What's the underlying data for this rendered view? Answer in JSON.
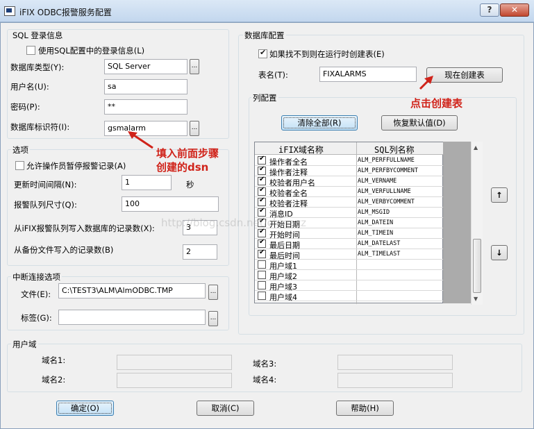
{
  "window": {
    "title": "iFIX ODBC报警服务配置",
    "help_glyph": "?",
    "close_glyph": "✕"
  },
  "sql_login": {
    "title": "SQL 登录信息",
    "use_sql_config_label": "使用SQL配置中的登录信息(L)",
    "use_sql_config_checked": false,
    "db_type_label": "数据库类型(Y):",
    "db_type_value": "SQL Server",
    "username_label": "用户名(U):",
    "username_value": "sa",
    "password_label": "密码(P):",
    "password_value": "**",
    "dsn_label": "数据库标识符(I):",
    "dsn_value": "gsmalarm"
  },
  "options": {
    "title": "选项",
    "allow_pause_label": "允许操作员暂停报警记录(A)",
    "allow_pause_checked": false,
    "update_interval_label": "更新时间间隔(N):",
    "update_interval_value": "1",
    "update_interval_unit": "秒",
    "queue_size_label": "报警队列尺寸(Q):",
    "queue_size_value": "100",
    "write_records_label": "从iFIX报警队列写入数据库的记录数(X):",
    "write_records_value": "3",
    "backup_records_label": "从备份文件写入的记录数(B)",
    "backup_records_value": "2"
  },
  "interrupt": {
    "title": "中断连接选项",
    "file_label": "文件(E):",
    "file_value": "C:\\TEST3\\ALM\\AlmODBC.TMP",
    "tag_label": "标签(G):",
    "tag_value": ""
  },
  "database": {
    "title": "数据库配置",
    "create_if_missing_label": "如果找不到则在运行时创建表(E)",
    "create_if_missing_checked": true,
    "table_label": "表名(T):",
    "table_value": "FIXALARMS",
    "create_now_button": "现在创建表"
  },
  "columns": {
    "title": "列配置",
    "clear_all_button": "清除全部(R)",
    "restore_default_button": "恢复默认值(D)",
    "header_ifix": "iFIX域名称",
    "header_sql": "SQL列名称",
    "rows": [
      {
        "checked": true,
        "ifix": "操作者全名",
        "sql": "ALM_PERFFULLNAME"
      },
      {
        "checked": true,
        "ifix": "操作者注释",
        "sql": "ALM_PERFBYCOMMENT"
      },
      {
        "checked": true,
        "ifix": "校验者用户名",
        "sql": "ALM_VERNAME"
      },
      {
        "checked": true,
        "ifix": "校验者全名",
        "sql": "ALM_VERFULLNAME"
      },
      {
        "checked": true,
        "ifix": "校验者注释",
        "sql": "ALM_VERBYCOMMENT"
      },
      {
        "checked": true,
        "ifix": "消息ID",
        "sql": "ALM_MSGID"
      },
      {
        "checked": true,
        "ifix": "开始日期",
        "sql": "ALM_DATEIN"
      },
      {
        "checked": true,
        "ifix": "开始时间",
        "sql": "ALM_TIMEIN"
      },
      {
        "checked": true,
        "ifix": "最后日期",
        "sql": "ALM_DATELAST"
      },
      {
        "checked": true,
        "ifix": "最后时间",
        "sql": "ALM_TIMELAST"
      },
      {
        "checked": false,
        "ifix": "用户域1",
        "sql": ""
      },
      {
        "checked": false,
        "ifix": "用户域2",
        "sql": ""
      },
      {
        "checked": false,
        "ifix": "用户域3",
        "sql": ""
      },
      {
        "checked": false,
        "ifix": "用户域4",
        "sql": ""
      }
    ],
    "move_up_glyph": "↑",
    "move_down_glyph": "↓"
  },
  "user_fields": {
    "title": "用户域",
    "field1_label": "域名1:",
    "field2_label": "域名2:",
    "field3_label": "域名3:",
    "field4_label": "域名4:"
  },
  "footer": {
    "ok_button": "确定(O)",
    "cancel_button": "取消(C)",
    "help_button": "帮助(H)"
  },
  "annotations": {
    "dsn_note_line1": "填入前面步骤",
    "dsn_note_line2": "创建的dsn",
    "create_note": "点击创建表",
    "watermark": "http://blog.csdn.net/chinazz"
  },
  "colors": {
    "annotation_red": "#d0231a",
    "titlebar": "#c3d7ee"
  }
}
